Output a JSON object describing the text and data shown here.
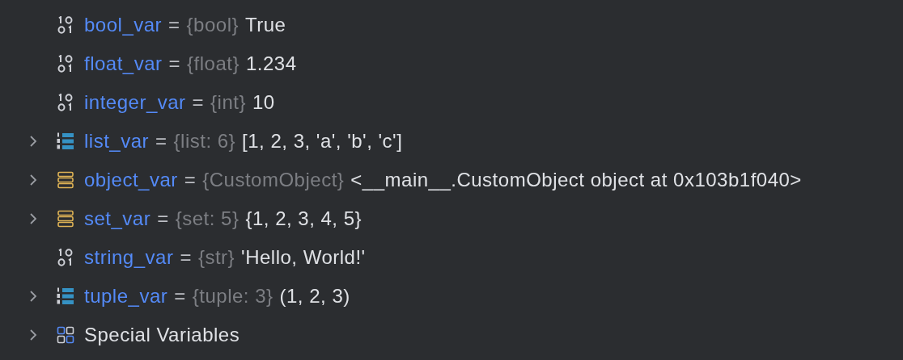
{
  "variables": [
    {
      "kind": "primitive",
      "expandable": false,
      "name": "bool_var",
      "separator": "=",
      "type": "{bool}",
      "value": "True"
    },
    {
      "kind": "primitive",
      "expandable": false,
      "name": "float_var",
      "separator": "=",
      "type": "{float}",
      "value": "1.234"
    },
    {
      "kind": "primitive",
      "expandable": false,
      "name": "integer_var",
      "separator": "=",
      "type": "{int}",
      "value": "10"
    },
    {
      "kind": "sequence",
      "expandable": true,
      "name": "list_var",
      "separator": "=",
      "type": "{list: 6}",
      "value": "[1, 2, 3, 'a', 'b', 'c']"
    },
    {
      "kind": "object",
      "expandable": true,
      "name": "object_var",
      "separator": "=",
      "type": "{CustomObject}",
      "value": "<__main__.CustomObject object at 0x103b1f040>"
    },
    {
      "kind": "object",
      "expandable": true,
      "name": "set_var",
      "separator": "=",
      "type": "{set: 5}",
      "value": "{1, 2, 3, 4, 5}"
    },
    {
      "kind": "primitive",
      "expandable": false,
      "name": "string_var",
      "separator": "=",
      "type": "{str}",
      "value": "'Hello, World!'"
    },
    {
      "kind": "sequence",
      "expandable": true,
      "name": "tuple_var",
      "separator": "=",
      "type": "{tuple: 3}",
      "value": "(1, 2, 3)"
    },
    {
      "kind": "group",
      "expandable": true,
      "name": "Special Variables"
    }
  ]
}
